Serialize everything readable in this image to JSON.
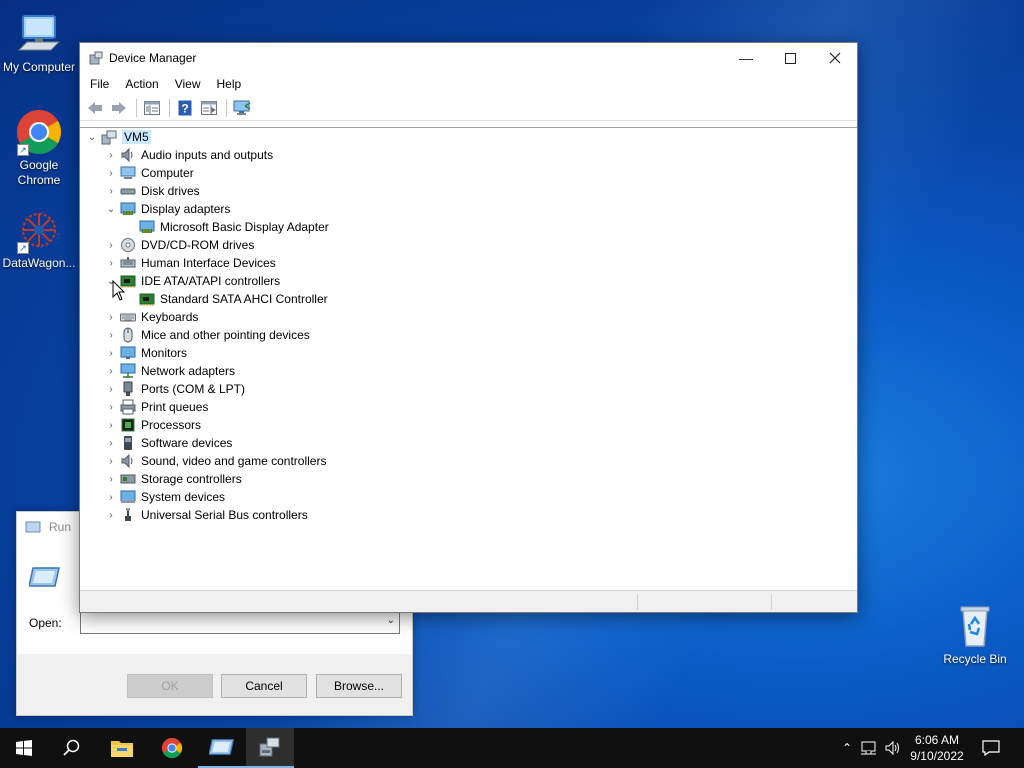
{
  "desktop": {
    "icons": [
      {
        "label": "My Computer",
        "icon": "monitor-icon"
      },
      {
        "label": "Google Chrome",
        "icon": "chrome-icon"
      },
      {
        "label": "DataWagon...",
        "icon": "datawagon-icon"
      },
      {
        "label": "Recycle Bin",
        "icon": "recycle-bin-icon"
      }
    ]
  },
  "run_dialog": {
    "title": "Run",
    "open_label": "Open:",
    "open_value": "",
    "ok_label": "OK",
    "cancel_label": "Cancel",
    "browse_label": "Browse..."
  },
  "device_manager": {
    "title": "Device Manager",
    "menu": [
      "File",
      "Action",
      "View",
      "Help"
    ],
    "toolbar": [
      "back-icon",
      "forward-icon",
      "properties-grid-icon",
      "help-icon",
      "view-pane-icon",
      "monitor-scan-icon"
    ],
    "root": "VM5",
    "tree": [
      {
        "label": "Audio inputs and outputs",
        "icon": "speaker-icon",
        "expanded": false
      },
      {
        "label": "Computer",
        "icon": "computer-icon",
        "expanded": false
      },
      {
        "label": "Disk drives",
        "icon": "disk-drive-icon",
        "expanded": false
      },
      {
        "label": "Display adapters",
        "icon": "display-adapter-icon",
        "expanded": true,
        "children": [
          {
            "label": "Microsoft Basic Display Adapter",
            "icon": "display-adapter-icon"
          }
        ]
      },
      {
        "label": "DVD/CD-ROM drives",
        "icon": "dvd-icon",
        "expanded": false
      },
      {
        "label": "Human Interface Devices",
        "icon": "hid-icon",
        "expanded": false
      },
      {
        "label": "IDE ATA/ATAPI controllers",
        "icon": "ide-controller-icon",
        "expanded": true,
        "children": [
          {
            "label": "Standard SATA AHCI Controller",
            "icon": "ide-controller-icon"
          }
        ]
      },
      {
        "label": "Keyboards",
        "icon": "keyboard-icon",
        "expanded": false
      },
      {
        "label": "Mice and other pointing devices",
        "icon": "mouse-icon",
        "expanded": false
      },
      {
        "label": "Monitors",
        "icon": "monitor-icon",
        "expanded": false
      },
      {
        "label": "Network adapters",
        "icon": "network-icon",
        "expanded": false
      },
      {
        "label": "Ports (COM & LPT)",
        "icon": "port-icon",
        "expanded": false
      },
      {
        "label": "Print queues",
        "icon": "printer-icon",
        "expanded": false
      },
      {
        "label": "Processors",
        "icon": "processor-icon",
        "expanded": false
      },
      {
        "label": "Software devices",
        "icon": "software-device-icon",
        "expanded": false
      },
      {
        "label": "Sound, video and game controllers",
        "icon": "speaker-icon",
        "expanded": false
      },
      {
        "label": "Storage controllers",
        "icon": "storage-controller-icon",
        "expanded": false
      },
      {
        "label": "System devices",
        "icon": "system-device-icon",
        "expanded": false
      },
      {
        "label": "Universal Serial Bus controllers",
        "icon": "usb-icon",
        "expanded": false
      }
    ]
  },
  "taskbar": {
    "apps": [
      "start-icon",
      "search-icon",
      "file-explorer-icon",
      "chrome-icon",
      "run-icon",
      "device-manager-icon"
    ],
    "time": "6:06 AM",
    "date": "9/10/2022"
  },
  "colors": {
    "accent": "#0078d7",
    "selection": "#cce8ff",
    "taskbar": "#101010"
  }
}
